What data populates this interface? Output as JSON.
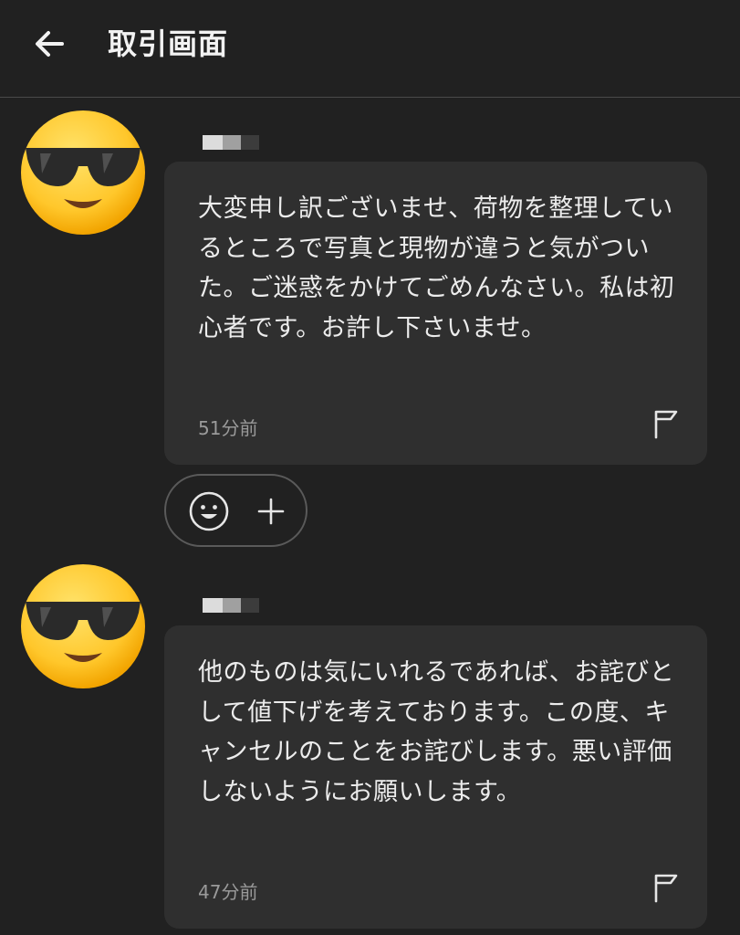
{
  "header": {
    "back_icon": "arrow-left-icon",
    "title": "取引画面"
  },
  "messages": [
    {
      "avatar_icon": "sunglasses-face-emoji",
      "text": "大変申し訳ございませ、荷物を整理しているところで写真と現物が違うと気がついた。ご迷惑をかけてごめんなさい。私は初心者です。お許し下さいませ。",
      "time": "51分前",
      "flag_icon": "flag-icon"
    },
    {
      "avatar_icon": "sunglasses-face-emoji",
      "text": "他のものは気にいれるであれば、お詫びとして値下げを考えております。この度、キャンセルのことをお詫びします。悪い評価しないようにお願いします。",
      "time": "47分前",
      "flag_icon": "flag-icon"
    }
  ],
  "reaction": {
    "emoji_icon": "smiley-face-icon",
    "add_icon": "plus-icon"
  },
  "colors": {
    "background": "#212121",
    "bubble": "#2f2f2f",
    "text": "#ececec",
    "muted": "#9a9a9a",
    "divider": "#4a4a4a"
  }
}
